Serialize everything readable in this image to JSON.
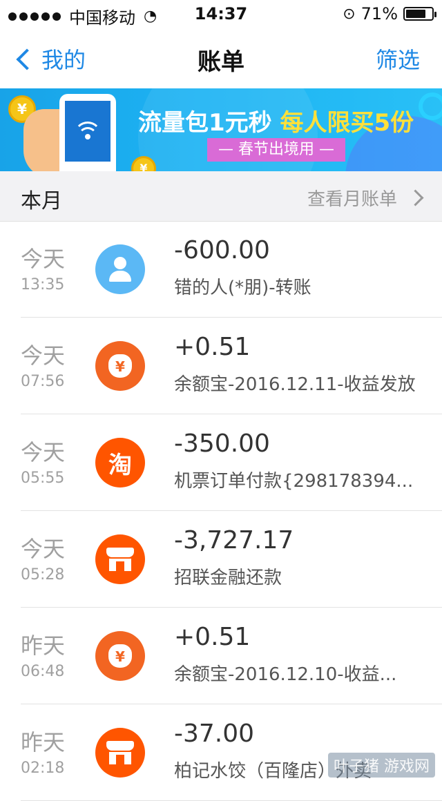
{
  "status": {
    "carrier": "中国移动",
    "time": "14:37",
    "battery": "71%",
    "battery_level": 0.71
  },
  "nav": {
    "back_label": "我的",
    "title": "账单",
    "filter_label": "筛选"
  },
  "banner": {
    "main_text_a": "流量包1元秒",
    "main_text_b": "每人限买5份",
    "tag": "— 春节出境用 —",
    "accent_color": "#ffe03a"
  },
  "month": {
    "title": "本月",
    "link": "查看月账单"
  },
  "transactions": [
    {
      "day": "今天",
      "time": "13:35",
      "amount": "-600.00",
      "desc": "错的人(*朋)-转账",
      "icon": "person-icon"
    },
    {
      "day": "今天",
      "time": "07:56",
      "amount": "+0.51",
      "desc": "余额宝-2016.12.11-收益发放",
      "icon": "money-bag-icon"
    },
    {
      "day": "今天",
      "time": "05:55",
      "amount": "-350.00",
      "desc": "机票订单付款{298178394...",
      "icon": "taobao-icon"
    },
    {
      "day": "今天",
      "time": "05:28",
      "amount": "-3,727.17",
      "desc": "招联金融还款",
      "icon": "store-icon"
    },
    {
      "day": "昨天",
      "time": "06:48",
      "amount": "+0.51",
      "desc": "余额宝-2016.12.10-收益...",
      "icon": "money-bag-icon"
    },
    {
      "day": "昨天",
      "time": "02:18",
      "amount": "-37.00",
      "desc": "柏记水饺（百隆店）外卖",
      "icon": "store-icon"
    }
  ],
  "watermark": "叶子猪 游戏网"
}
